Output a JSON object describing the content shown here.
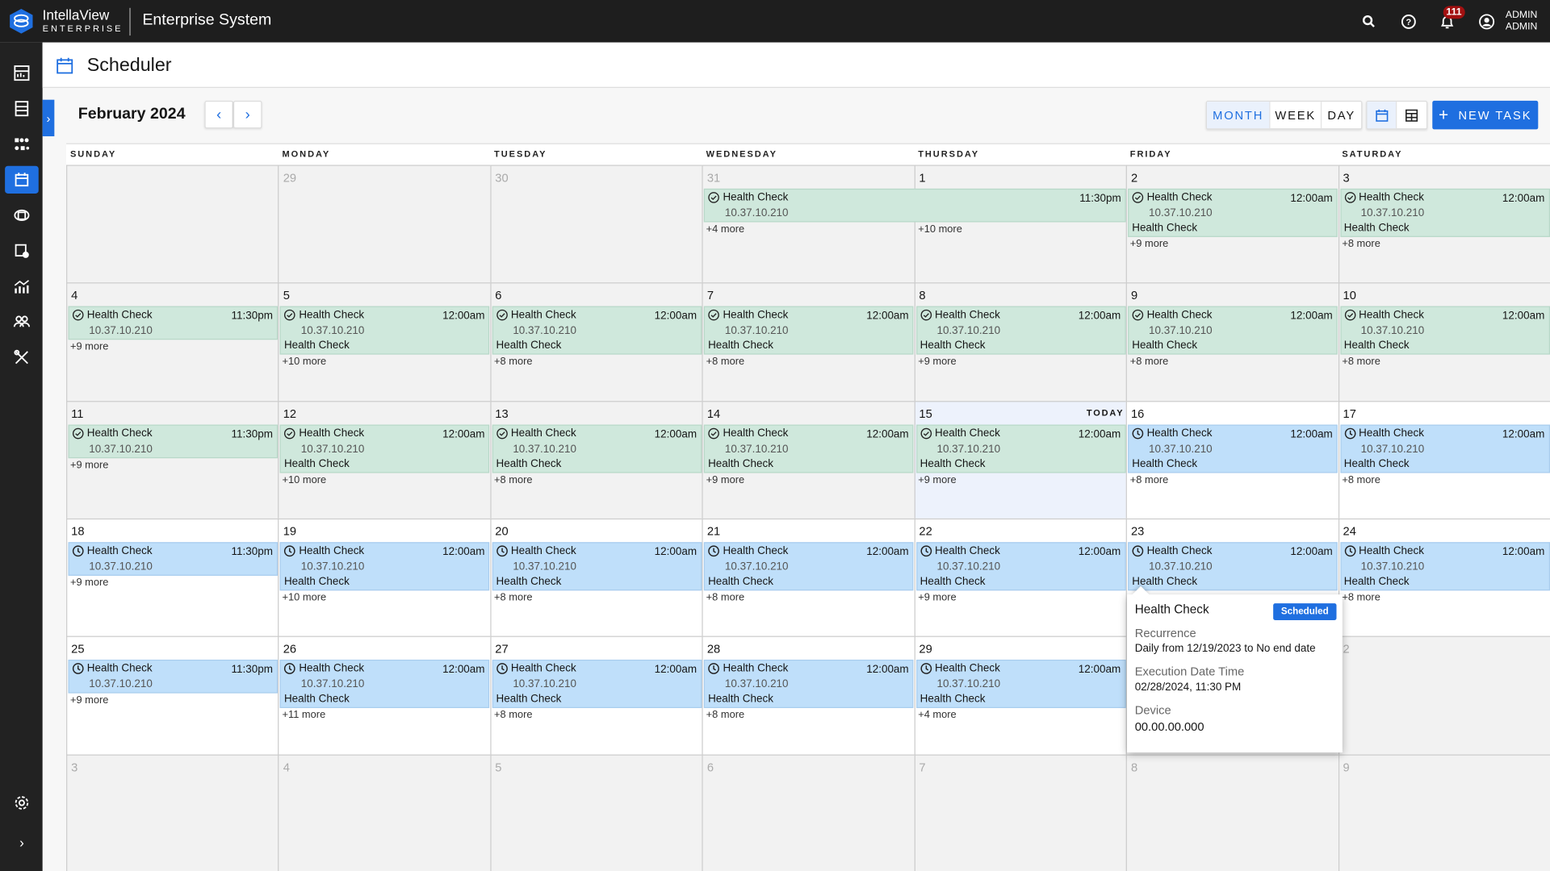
{
  "topbar": {
    "brand": "IntellaView",
    "brand_sub": "ENTERPRISE",
    "app_title": "Enterprise System",
    "notification_count": "111",
    "user_line1": "ADMIN",
    "user_line2": "ADMIN"
  },
  "sidebar": {
    "items": [
      "dashboard",
      "devices",
      "topology",
      "scheduler",
      "network",
      "device-settings",
      "analytics",
      "users",
      "tools"
    ],
    "active": "scheduler",
    "bottom": [
      "settings",
      "expand"
    ]
  },
  "page": {
    "title": "Scheduler"
  },
  "toolbar": {
    "month_label": "February 2024",
    "views": [
      "MONTH",
      "WEEK",
      "DAY"
    ],
    "active_view": "MONTH",
    "new_task": "NEW TASK"
  },
  "colors": {
    "accent": "#1f6fe0",
    "completed": "#cfe8dc",
    "scheduled": "#bfdffa"
  },
  "calendar": {
    "day_headers": [
      "SUNDAY",
      "MONDAY",
      "TUESDAY",
      "WEDNESDAY",
      "THURSDAY",
      "FRIDAY",
      "SATURDAY"
    ],
    "today_label": "TODAY",
    "weeks": [
      {
        "days": [
          {
            "num": "",
            "muted": true
          },
          {
            "num": "29",
            "muted": true
          },
          {
            "num": "30",
            "muted": true
          },
          {
            "num": "31",
            "muted": true,
            "span": 2,
            "event": {
              "status": "done",
              "title": "Health Check",
              "ip": "10.37.10.210",
              "time": "11:30pm"
            },
            "more": "+4 more"
          },
          {
            "num": "1",
            "past": true,
            "more": "+10 more",
            "more_offset": "span"
          },
          {
            "num": "2",
            "past": true,
            "event": {
              "status": "done",
              "title": "Health Check",
              "ip": "10.37.10.210",
              "time": "12:00am",
              "sub": "Health Check"
            },
            "more": "+9 more"
          },
          {
            "num": "3",
            "past": true,
            "event": {
              "status": "done",
              "title": "Health Check",
              "ip": "10.37.10.210",
              "time": "12:00am",
              "sub": "Health Check"
            },
            "more": "+8 more"
          }
        ]
      },
      {
        "days": [
          {
            "num": "4",
            "past": true,
            "event": {
              "status": "done",
              "title": "Health Check",
              "ip": "10.37.10.210",
              "time": "11:30pm"
            },
            "more": "+9 more"
          },
          {
            "num": "5",
            "past": true,
            "event": {
              "status": "done",
              "title": "Health Check",
              "ip": "10.37.10.210",
              "time": "12:00am",
              "sub": "Health Check"
            },
            "more": "+10 more"
          },
          {
            "num": "6",
            "past": true,
            "event": {
              "status": "done",
              "title": "Health Check",
              "ip": "10.37.10.210",
              "time": "12:00am",
              "sub": "Health Check"
            },
            "more": "+8 more"
          },
          {
            "num": "7",
            "past": true,
            "event": {
              "status": "done",
              "title": "Health Check",
              "ip": "10.37.10.210",
              "time": "12:00am",
              "sub": "Health Check"
            },
            "more": "+8 more"
          },
          {
            "num": "8",
            "past": true,
            "event": {
              "status": "done",
              "title": "Health Check",
              "ip": "10.37.10.210",
              "time": "12:00am",
              "sub": "Health Check"
            },
            "more": "+9 more"
          },
          {
            "num": "9",
            "past": true,
            "event": {
              "status": "done",
              "title": "Health Check",
              "ip": "10.37.10.210",
              "time": "12:00am",
              "sub": "Health Check"
            },
            "more": "+8 more"
          },
          {
            "num": "10",
            "past": true,
            "event": {
              "status": "done",
              "title": "Health Check",
              "ip": "10.37.10.210",
              "time": "12:00am",
              "sub": "Health Check"
            },
            "more": "+8 more"
          }
        ]
      },
      {
        "days": [
          {
            "num": "11",
            "past": true,
            "event": {
              "status": "done",
              "title": "Health Check",
              "ip": "10.37.10.210",
              "time": "11:30pm"
            },
            "more": "+9 more"
          },
          {
            "num": "12",
            "past": true,
            "event": {
              "status": "done",
              "title": "Health Check",
              "ip": "10.37.10.210",
              "time": "12:00am",
              "sub": "Health Check"
            },
            "more": "+10 more"
          },
          {
            "num": "13",
            "past": true,
            "event": {
              "status": "done",
              "title": "Health Check",
              "ip": "10.37.10.210",
              "time": "12:00am",
              "sub": "Health Check"
            },
            "more": "+8 more"
          },
          {
            "num": "14",
            "past": true,
            "event": {
              "status": "done",
              "title": "Health Check",
              "ip": "10.37.10.210",
              "time": "12:00am",
              "sub": "Health Check"
            },
            "more": "+9 more"
          },
          {
            "num": "15",
            "today": true,
            "event": {
              "status": "done",
              "title": "Health Check",
              "ip": "10.37.10.210",
              "time": "12:00am",
              "sub": "Health Check"
            },
            "more": "+9 more"
          },
          {
            "num": "16",
            "event": {
              "status": "sched",
              "title": "Health Check",
              "ip": "10.37.10.210",
              "time": "12:00am",
              "sub": "Health Check"
            },
            "more": "+8 more"
          },
          {
            "num": "17",
            "event": {
              "status": "sched",
              "title": "Health Check",
              "ip": "10.37.10.210",
              "time": "12:00am",
              "sub": "Health Check"
            },
            "more": "+8 more"
          }
        ]
      },
      {
        "days": [
          {
            "num": "18",
            "event": {
              "status": "sched",
              "title": "Health Check",
              "ip": "10.37.10.210",
              "time": "11:30pm"
            },
            "more": "+9 more"
          },
          {
            "num": "19",
            "event": {
              "status": "sched",
              "title": "Health Check",
              "ip": "10.37.10.210",
              "time": "12:00am",
              "sub": "Health Check"
            },
            "more": "+10 more"
          },
          {
            "num": "20",
            "event": {
              "status": "sched",
              "title": "Health Check",
              "ip": "10.37.10.210",
              "time": "12:00am",
              "sub": "Health Check"
            },
            "more": "+8 more"
          },
          {
            "num": "21",
            "event": {
              "status": "sched",
              "title": "Health Check",
              "ip": "10.37.10.210",
              "time": "12:00am",
              "sub": "Health Check"
            },
            "more": "+8 more"
          },
          {
            "num": "22",
            "event": {
              "status": "sched",
              "title": "Health Check",
              "ip": "10.37.10.210",
              "time": "12:00am",
              "sub": "Health Check"
            },
            "more": "+9 more"
          },
          {
            "num": "23",
            "event": {
              "status": "sched",
              "title": "Health Check",
              "ip": "10.37.10.210",
              "time": "12:00am",
              "sub": "Health Check"
            }
          },
          {
            "num": "24",
            "event": {
              "status": "sched",
              "title": "Health Check",
              "ip": "10.37.10.210",
              "time": "12:00am",
              "sub": "Health Check"
            },
            "more": "+8 more"
          }
        ]
      },
      {
        "days": [
          {
            "num": "25",
            "event": {
              "status": "sched",
              "title": "Health Check",
              "ip": "10.37.10.210",
              "time": "11:30pm"
            },
            "more": "+9 more"
          },
          {
            "num": "26",
            "event": {
              "status": "sched",
              "title": "Health Check",
              "ip": "10.37.10.210",
              "time": "12:00am",
              "sub": "Health Check"
            },
            "more": "+11 more"
          },
          {
            "num": "27",
            "event": {
              "status": "sched",
              "title": "Health Check",
              "ip": "10.37.10.210",
              "time": "12:00am",
              "sub": "Health Check"
            },
            "more": "+8 more"
          },
          {
            "num": "28",
            "event": {
              "status": "sched",
              "title": "Health Check",
              "ip": "10.37.10.210",
              "time": "12:00am",
              "sub": "Health Check"
            },
            "more": "+8 more"
          },
          {
            "num": "29",
            "event": {
              "status": "sched",
              "title": "Health Check",
              "ip": "10.37.10.210",
              "time": "12:00am",
              "sub": "Health Check"
            },
            "more": "+4 more"
          },
          {
            "num": "1",
            "muted": true
          },
          {
            "num": "2",
            "muted": true
          }
        ]
      },
      {
        "days": [
          {
            "num": "3",
            "muted": true
          },
          {
            "num": "4",
            "muted": true
          },
          {
            "num": "5",
            "muted": true
          },
          {
            "num": "6",
            "muted": true
          },
          {
            "num": "7",
            "muted": true
          },
          {
            "num": "8",
            "muted": true
          },
          {
            "num": "9",
            "muted": true
          }
        ]
      }
    ]
  },
  "popover": {
    "title": "Health Check",
    "status": "Scheduled",
    "recurrence_label": "Recurrence",
    "recurrence": "Daily from 12/19/2023 to No end date",
    "exec_label": "Execution Date Time",
    "exec": "02/28/2024, 11:30 PM",
    "device_label": "Device",
    "device": "00.00.00.000"
  }
}
